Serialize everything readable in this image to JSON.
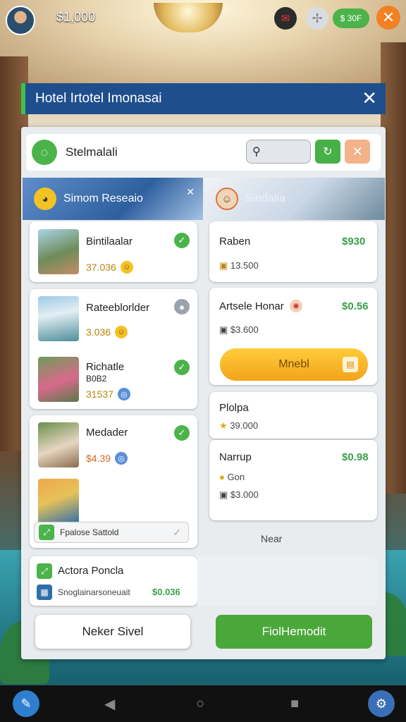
{
  "hud": {
    "coins": "$1,000",
    "cash_label": "$ 30F"
  },
  "title": "Hotel Irtotel Imonasai",
  "search": {
    "brand": "Stelmalali"
  },
  "tabs": [
    {
      "label": "Simom Reseaio"
    },
    {
      "label": "Sindalia"
    }
  ],
  "left_list": [
    {
      "name": "Bintilaalar",
      "value": "37.036"
    },
    {
      "name": "Rateeblorlder",
      "value": "3.036"
    },
    {
      "name": "Richatle",
      "name2": "B0B2",
      "value": "31537"
    },
    {
      "name": "Medader",
      "value": "$4.39"
    }
  ],
  "left_footer": "Fpalose Sattold",
  "right_list": [
    {
      "name": "Raben",
      "price": "$930",
      "sub": "13.500"
    },
    {
      "name": "Artsele Honar",
      "price": "$0.56",
      "sub": "$3.600"
    },
    {
      "name": "Plolpa",
      "sub": "39.000"
    },
    {
      "name": "Narrup",
      "price": "$0.98",
      "sub1": "Gon",
      "sub2": "$3.000"
    }
  ],
  "right_button": "Mnebl",
  "near_label": "Near",
  "bottom_card": {
    "title": "Actora Poncla",
    "sub": "Snoglainarsoneuait",
    "price": "$0.036"
  },
  "buttons": {
    "secondary": "Neker Sivel",
    "primary": "FiolHemodit"
  },
  "colors": {
    "accent_green": "#4bb34a",
    "title_blue": "#1f4e8c",
    "button_orange": "#f2a31c",
    "close_orange": "#f28024"
  }
}
